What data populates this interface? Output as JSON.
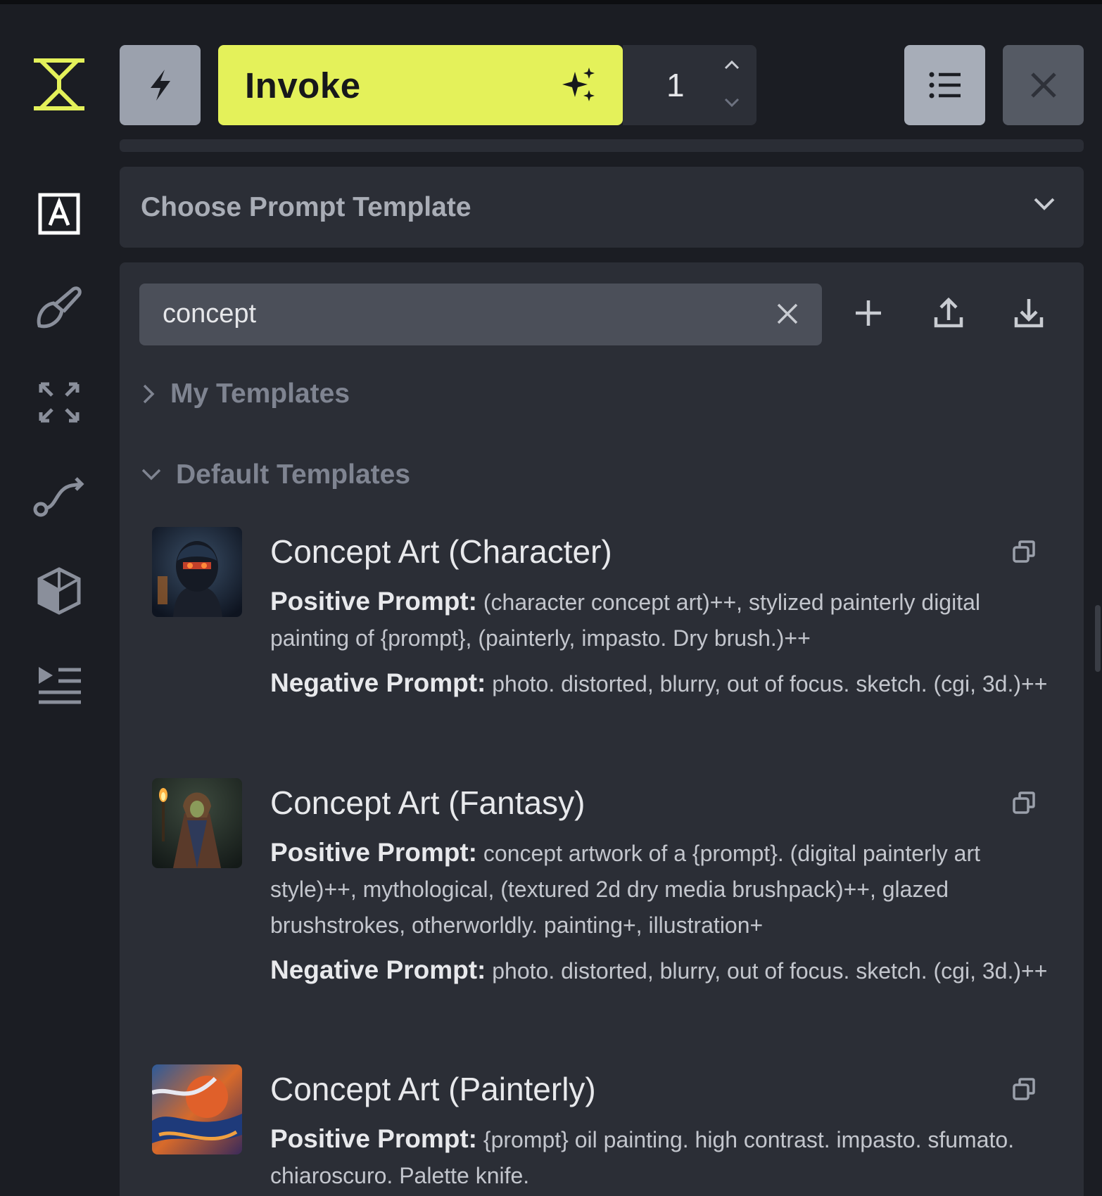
{
  "toolbar": {
    "invoke_label": "Invoke",
    "iterations_value": "1"
  },
  "icons": {
    "logo": "invoke-logo-icon",
    "text": "text-a-icon",
    "brush": "brush-icon",
    "upscale": "expand-arrows-icon",
    "workflow": "workflow-icon",
    "models": "cube-icon",
    "queue": "queue-list-icon",
    "flash": "lightning-icon",
    "sparkle": "sparkles-icon",
    "list": "list-icon",
    "close": "close-icon"
  },
  "prompt_template": {
    "placeholder": "Choose Prompt Template"
  },
  "search": {
    "value": "concept"
  },
  "sections": {
    "my_templates": "My Templates",
    "default_templates": "Default Templates"
  },
  "templates": [
    {
      "title": "Concept Art (Character)",
      "positive_label": "Positive Prompt:",
      "positive": "(character concept art)++, stylized painterly digital painting of {prompt}, (painterly, impasto. Dry brush.)++",
      "negative_label": "Negative Prompt:",
      "negative": "photo. distorted, blurry, out of focus. sketch. (cgi, 3d.)++"
    },
    {
      "title": "Concept Art (Fantasy)",
      "positive_label": "Positive Prompt:",
      "positive": "concept artwork of a {prompt}. (digital painterly art style)++, mythological, (textured 2d dry media brushpack)++, glazed brushstrokes, otherworldly. painting+, illustration+",
      "negative_label": "Negative Prompt:",
      "negative": "photo. distorted, blurry, out of focus. sketch. (cgi, 3d.)++"
    },
    {
      "title": "Concept Art (Painterly)",
      "positive_label": "Positive Prompt:",
      "positive": "{prompt} oil painting. high contrast. impasto. sfumato. chiaroscuro. Palette knife."
    }
  ],
  "colors": {
    "accent": "#e4f15a",
    "background": "#1b1d23",
    "panel": "#2b2e36"
  }
}
